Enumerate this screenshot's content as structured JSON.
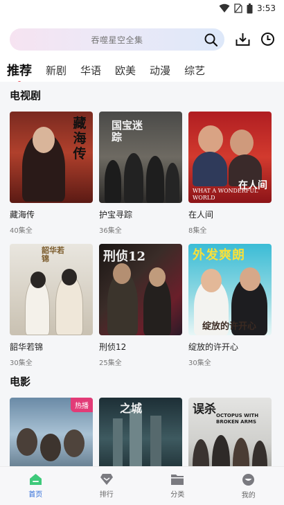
{
  "status_bar": {
    "time": "3:53"
  },
  "search": {
    "placeholder": "吞噬星空全集"
  },
  "tabs": [
    {
      "label": "推荐",
      "active": true
    },
    {
      "label": "新剧"
    },
    {
      "label": "华语"
    },
    {
      "label": "欧美"
    },
    {
      "label": "动漫"
    },
    {
      "label": "综艺"
    }
  ],
  "sections": {
    "tv": {
      "title": "电视剧",
      "items": [
        {
          "title": "藏海传",
          "subtitle": "40集全",
          "poster_text": "藏海传"
        },
        {
          "title": "护宝寻踪",
          "subtitle": "36集全",
          "poster_text": "国宝迷踪"
        },
        {
          "title": "在人间",
          "subtitle": "8集全",
          "poster_text": "在人间",
          "poster_text_en": "WHAT A WONDERFUL WORLD"
        },
        {
          "title": "韶华若锦",
          "subtitle": "30集全",
          "poster_text": "韶华若锦"
        },
        {
          "title": "刑侦12",
          "subtitle": "25集全",
          "poster_text": "刑侦12"
        },
        {
          "title": "绽放的许开心",
          "subtitle": "30集全",
          "poster_text": "外发爽朗",
          "poster_text_2": "绽放的许开心"
        }
      ]
    },
    "movie": {
      "title": "电影",
      "items": [
        {
          "badge": "热播"
        },
        {
          "poster_text": "之城"
        },
        {
          "poster_text": "误杀",
          "poster_text_en": "OCTOPUS WITH BROKEN ARMS"
        }
      ]
    }
  },
  "bottom_nav": [
    {
      "label": "首页",
      "icon": "home-icon",
      "active": true
    },
    {
      "label": "排行",
      "icon": "ranking-icon"
    },
    {
      "label": "分类",
      "icon": "folder-icon"
    },
    {
      "label": "我的",
      "icon": "profile-icon"
    }
  ],
  "colors": {
    "accent": "#2d6bd8",
    "tab_dot": "#e8414b",
    "badge": "#e23b77"
  }
}
